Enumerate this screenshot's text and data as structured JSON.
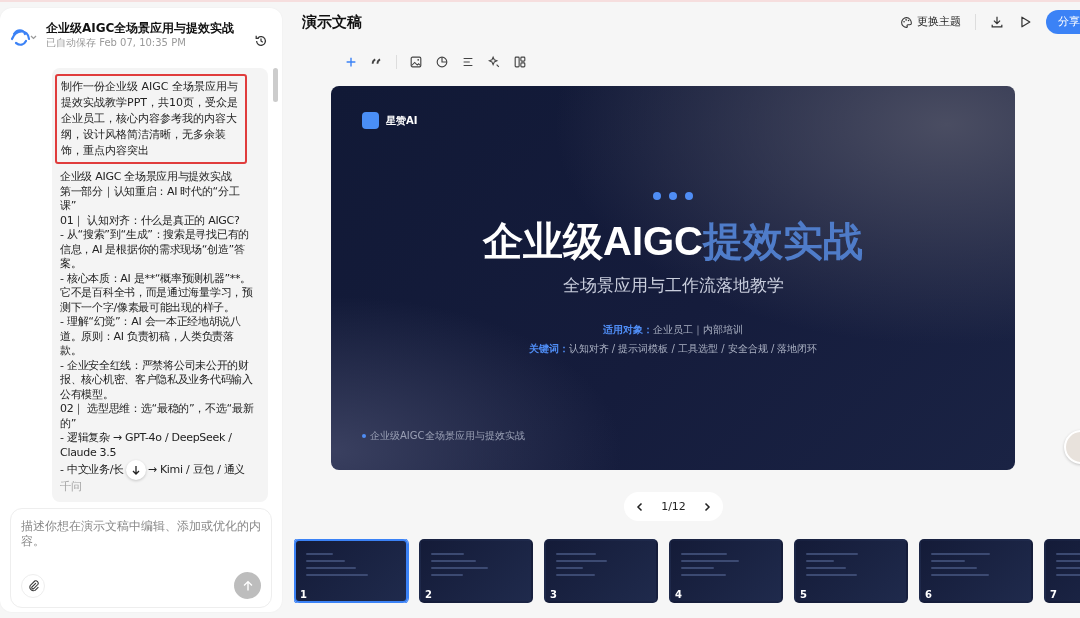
{
  "chat": {
    "title": "企业级AIGC全场景应用与提效实战",
    "saved": "已自动保存 Feb 07, 10:35 PM",
    "user_message": "制作一份企业级 AIGC 全场景应用与提效实战教学PPT，共10页，受众是企业员工，核心内容参考我的内容大纲，设计风格简洁清晰，无多余装饰，重点内容突出",
    "user_message_highlighted": true,
    "reply_lines": [
      "企业级 AIGC 全场景应用与提效实战",
      "第一部分｜认知重启：AI 时代的“分工课”",
      "01｜ 认知对齐：什么是真正的 AIGC?",
      "- 从“搜索”到“生成”：搜索是寻找已有的信息，AI 是根据你的需求现场“创造”答案。",
      "- 核心本质：AI 是**“概率预测机器”**。它不是百科全书，而是通过海量学习，预测下一个字/像素最可能出现的样子。",
      "- 理解“幻觉”：AI 会一本正经地胡说八道。原则：AI 负责初稿，人类负责落款。",
      "- 企业安全红线：严禁将公司未公开的财报、核心机密、客户隐私及业务代码输入公有模型。",
      "02｜ 选型思维：选“最稳的”，不选“最新的”",
      "- 逻辑复杂 → GPT-4o / DeepSeek / Claude 3.5"
    ],
    "cut_line": {
      "before": "- 中文业务/长",
      "after": "→ Kimi / 豆包 / 通义"
    },
    "faded_line": "千问",
    "input_placeholder": "描述你想在演示文稿中编辑、添加或优化的内容。"
  },
  "header": {
    "title": "演示文稿",
    "theme_button": "更换主题",
    "share_button": "分享"
  },
  "slide": {
    "brand": "星赞AI",
    "title_main": "企业级AIGC",
    "title_accent": "提效实战",
    "subtitle": "全场景应用与工作流落地教学",
    "meta": [
      {
        "label": "适用对象：",
        "value": "企业员工｜内部培训"
      },
      {
        "label": "关键词：",
        "value": "认知对齐 / 提示词模板 / 工具选型 / 安全合规 / 落地闭环"
      }
    ],
    "footer": "企业级AIGC全场景应用与提效实战"
  },
  "pager": {
    "text": "1/12"
  },
  "thumbnails": [
    {
      "number": "1",
      "selected": true
    },
    {
      "number": "2",
      "selected": false
    },
    {
      "number": "3",
      "selected": false
    },
    {
      "number": "4",
      "selected": false
    },
    {
      "number": "5",
      "selected": false
    },
    {
      "number": "6",
      "selected": false
    },
    {
      "number": "7",
      "selected": false
    }
  ]
}
